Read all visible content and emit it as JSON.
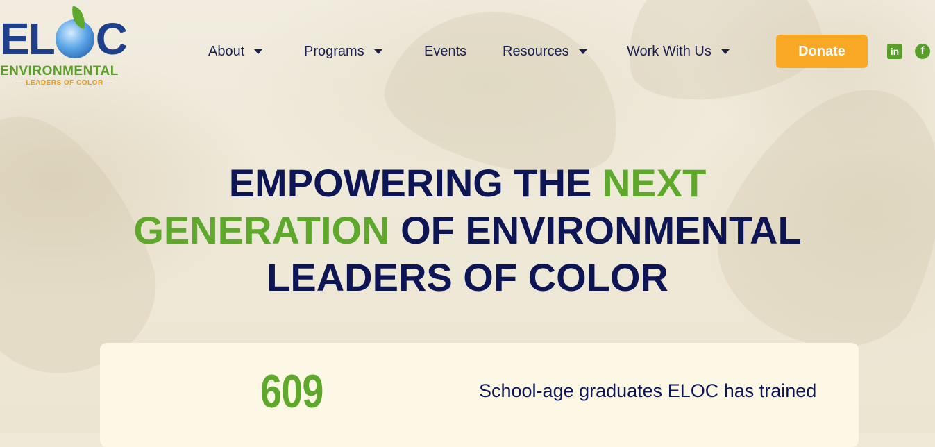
{
  "header": {
    "logo": {
      "wordmark": "ELOC",
      "name": "ENVIRONMENTAL",
      "tagline": "— LEADERS OF COLOR —"
    },
    "nav": [
      {
        "label": "About",
        "dropdown": true
      },
      {
        "label": "Programs",
        "dropdown": true
      },
      {
        "label": "Events",
        "dropdown": false
      },
      {
        "label": "Resources",
        "dropdown": true
      },
      {
        "label": "Work With Us",
        "dropdown": true
      }
    ],
    "donate_label": "Donate",
    "social": [
      {
        "icon": "linkedin-icon",
        "glyph": "in"
      },
      {
        "icon": "facebook-icon",
        "glyph": "f"
      }
    ]
  },
  "hero": {
    "line1_a": "EMPOWERING THE ",
    "line1_b": "NEXT",
    "line2_a": "GENERATION",
    "line2_b": " OF ENVIRONMENTAL",
    "line3": "LEADERS OF COLOR"
  },
  "stat": {
    "number": "609",
    "label": "School-age graduates ELOC has trained"
  },
  "colors": {
    "navy": "#0d1554",
    "green": "#5ea82b",
    "orange": "#f9a825",
    "card": "#fdf7e6"
  }
}
